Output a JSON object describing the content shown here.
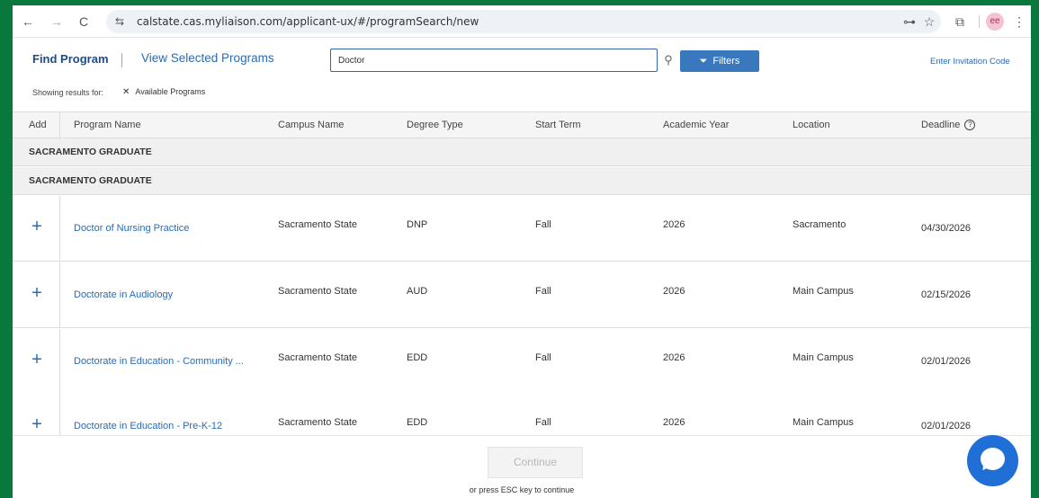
{
  "browser": {
    "url": "calstate.cas.myliaison.com/applicant-ux/#/programSearch/new",
    "back_icon": "←",
    "forward_icon": "→",
    "reload_icon": "C",
    "site_icon": "⇆",
    "key_icon": "⊶",
    "star_icon": "☆",
    "extension_icon": "⧉",
    "profile_icon": "ee",
    "menu_icon": "⋮"
  },
  "header": {
    "find_program": "Find Program",
    "view_selected": "View Selected Programs",
    "search_value": "Doctor",
    "search_icon": "⚲",
    "filters_label": "Filters",
    "filter_icon": "⏷",
    "invitation_link": "Enter Invitation Code",
    "showing_label": "Showing results for:",
    "chip_x": "✕",
    "chip_label": "Available Programs"
  },
  "table": {
    "columns": [
      "Add",
      "Program Name",
      "Campus Name",
      "Degree Type",
      "Start Term",
      "Academic Year",
      "Location",
      "Deadline"
    ],
    "deadline_help_icon": "?",
    "groups": [
      "SACRAMENTO GRADUATE",
      "SACRAMENTO GRADUATE"
    ],
    "add_symbol": "+",
    "rows": [
      {
        "program": "Doctor of Nursing Practice",
        "campus": "Sacramento State",
        "degree": "DNP",
        "term": "Fall",
        "year": "2026",
        "location": "Sacramento",
        "deadline": "04/30/2026"
      },
      {
        "program": "Doctorate in Audiology",
        "campus": "Sacramento State",
        "degree": "AUD",
        "term": "Fall",
        "year": "2026",
        "location": "Main Campus",
        "deadline": "02/15/2026"
      },
      {
        "program": "Doctorate in Education - Community ...",
        "campus": "Sacramento State",
        "degree": "EDD",
        "term": "Fall",
        "year": "2026",
        "location": "Main Campus",
        "deadline": "02/01/2026"
      },
      {
        "program": "Doctorate in Education - Pre-K-12",
        "campus": "Sacramento State",
        "degree": "EDD",
        "term": "Fall",
        "year": "2026",
        "location": "Main Campus",
        "deadline": "02/01/2026"
      }
    ]
  },
  "footer": {
    "continue_label": "Continue",
    "esc_hint": "or press ESC key to continue"
  },
  "colors": {
    "background": "#08783d",
    "link": "#2a6bb0",
    "filters_button": "#3a78be",
    "chat_button": "#1f6fd6"
  }
}
